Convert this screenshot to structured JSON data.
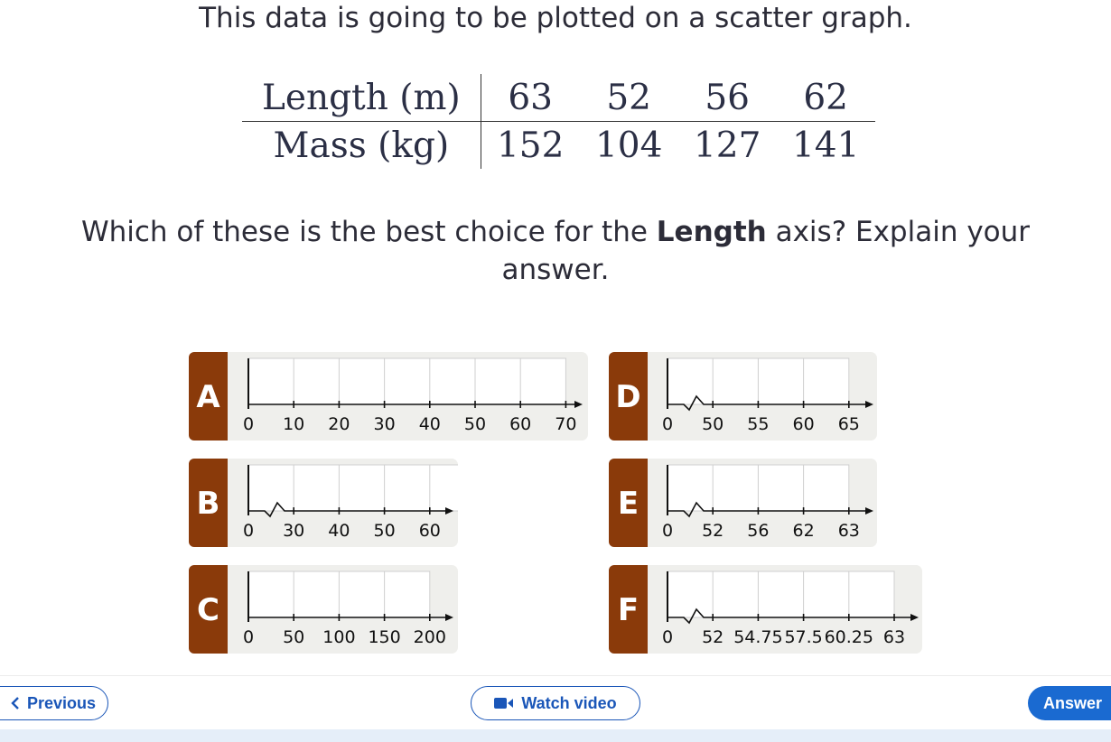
{
  "intro": "This data is going to be plotted on a scatter graph.",
  "table": {
    "row1_label": "Length (m)",
    "row1_values": [
      "63",
      "52",
      "56",
      "62"
    ],
    "row2_label": "Mass (kg)",
    "row2_values": [
      "152",
      "104",
      "127",
      "141"
    ]
  },
  "question": {
    "before": "Which of these is the best choice for the ",
    "bold": "Length",
    "after": " axis? Explain your answer."
  },
  "options": [
    {
      "letter": "A",
      "break": false,
      "ticks": [
        "0",
        "10",
        "20",
        "30",
        "40",
        "50",
        "60",
        "70"
      ]
    },
    {
      "letter": "B",
      "break": true,
      "ticks": [
        "0",
        "30",
        "40",
        "50",
        "60"
      ]
    },
    {
      "letter": "C",
      "break": false,
      "ticks": [
        "0",
        "50",
        "100",
        "150",
        "200"
      ]
    },
    {
      "letter": "D",
      "break": true,
      "ticks": [
        "0",
        "50",
        "55",
        "60",
        "65"
      ]
    },
    {
      "letter": "E",
      "break": true,
      "ticks": [
        "0",
        "52",
        "56",
        "62",
        "63"
      ]
    },
    {
      "letter": "F",
      "break": true,
      "ticks": [
        "0",
        "52",
        "54.75",
        "57.5",
        "60.25",
        "63"
      ]
    }
  ],
  "nav": {
    "previous": "Previous",
    "watch_video": "Watch video",
    "answer": "Answer"
  },
  "colors": {
    "letter_box": "#8a3a0a",
    "accent": "#1a56b8",
    "answer_bg": "#1a6ad1"
  }
}
